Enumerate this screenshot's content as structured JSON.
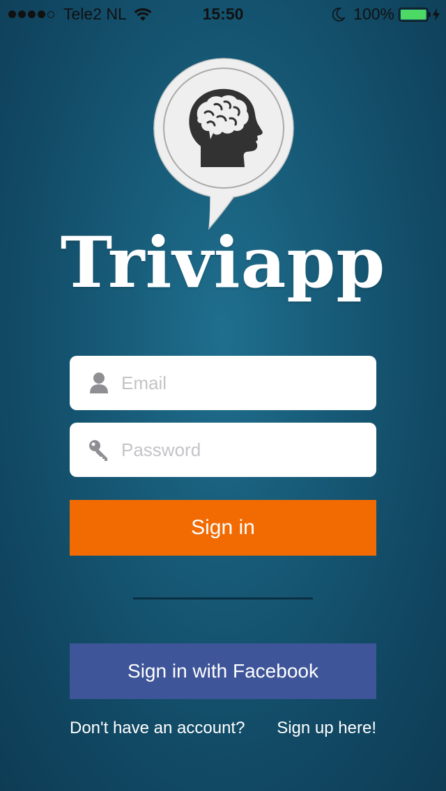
{
  "status_bar": {
    "carrier": "Tele2 NL",
    "time": "15:50",
    "battery": "100%",
    "icons": [
      "signal-dots-icon",
      "wifi-icon",
      "moon-icon",
      "battery-icon",
      "charging-bolt-icon"
    ]
  },
  "logo": {
    "icon": "brain-head-icon",
    "title": "Triviapp"
  },
  "login_form": {
    "email": {
      "placeholder": "Email",
      "value": "",
      "icon": "user-icon"
    },
    "password": {
      "placeholder": "Password",
      "value": "",
      "icon": "key-icon"
    },
    "signin_label": "Sign in",
    "facebook_label": "Sign in with Facebook"
  },
  "footer": {
    "prompt": "Don't have an account?",
    "signup_link": "Sign up here!"
  },
  "colors": {
    "background": "#175b78",
    "signin_button": "#f26b02",
    "facebook_button": "#3e5599",
    "battery_fill": "#4cd964"
  }
}
